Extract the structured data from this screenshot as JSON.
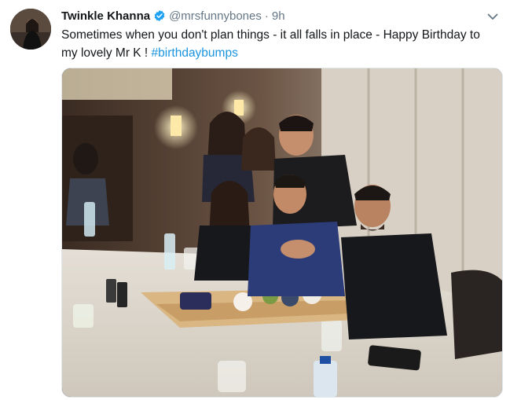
{
  "tweet": {
    "author_name": "Twinkle Khanna",
    "handle": "@mrsfunnybones",
    "separator": "·",
    "time": "9h",
    "text_main": "Sometimes when you don't plan things - it all falls in place - Happy Birthday to my lovely Mr K ! ",
    "hashtag": "#birthdaybumps",
    "verified_icon": "verified-badge-icon",
    "menu_icon": "chevron-down-icon"
  },
  "colors": {
    "link": "#1b95e0",
    "secondary_text": "#657786",
    "verified": "#1da1f2"
  }
}
